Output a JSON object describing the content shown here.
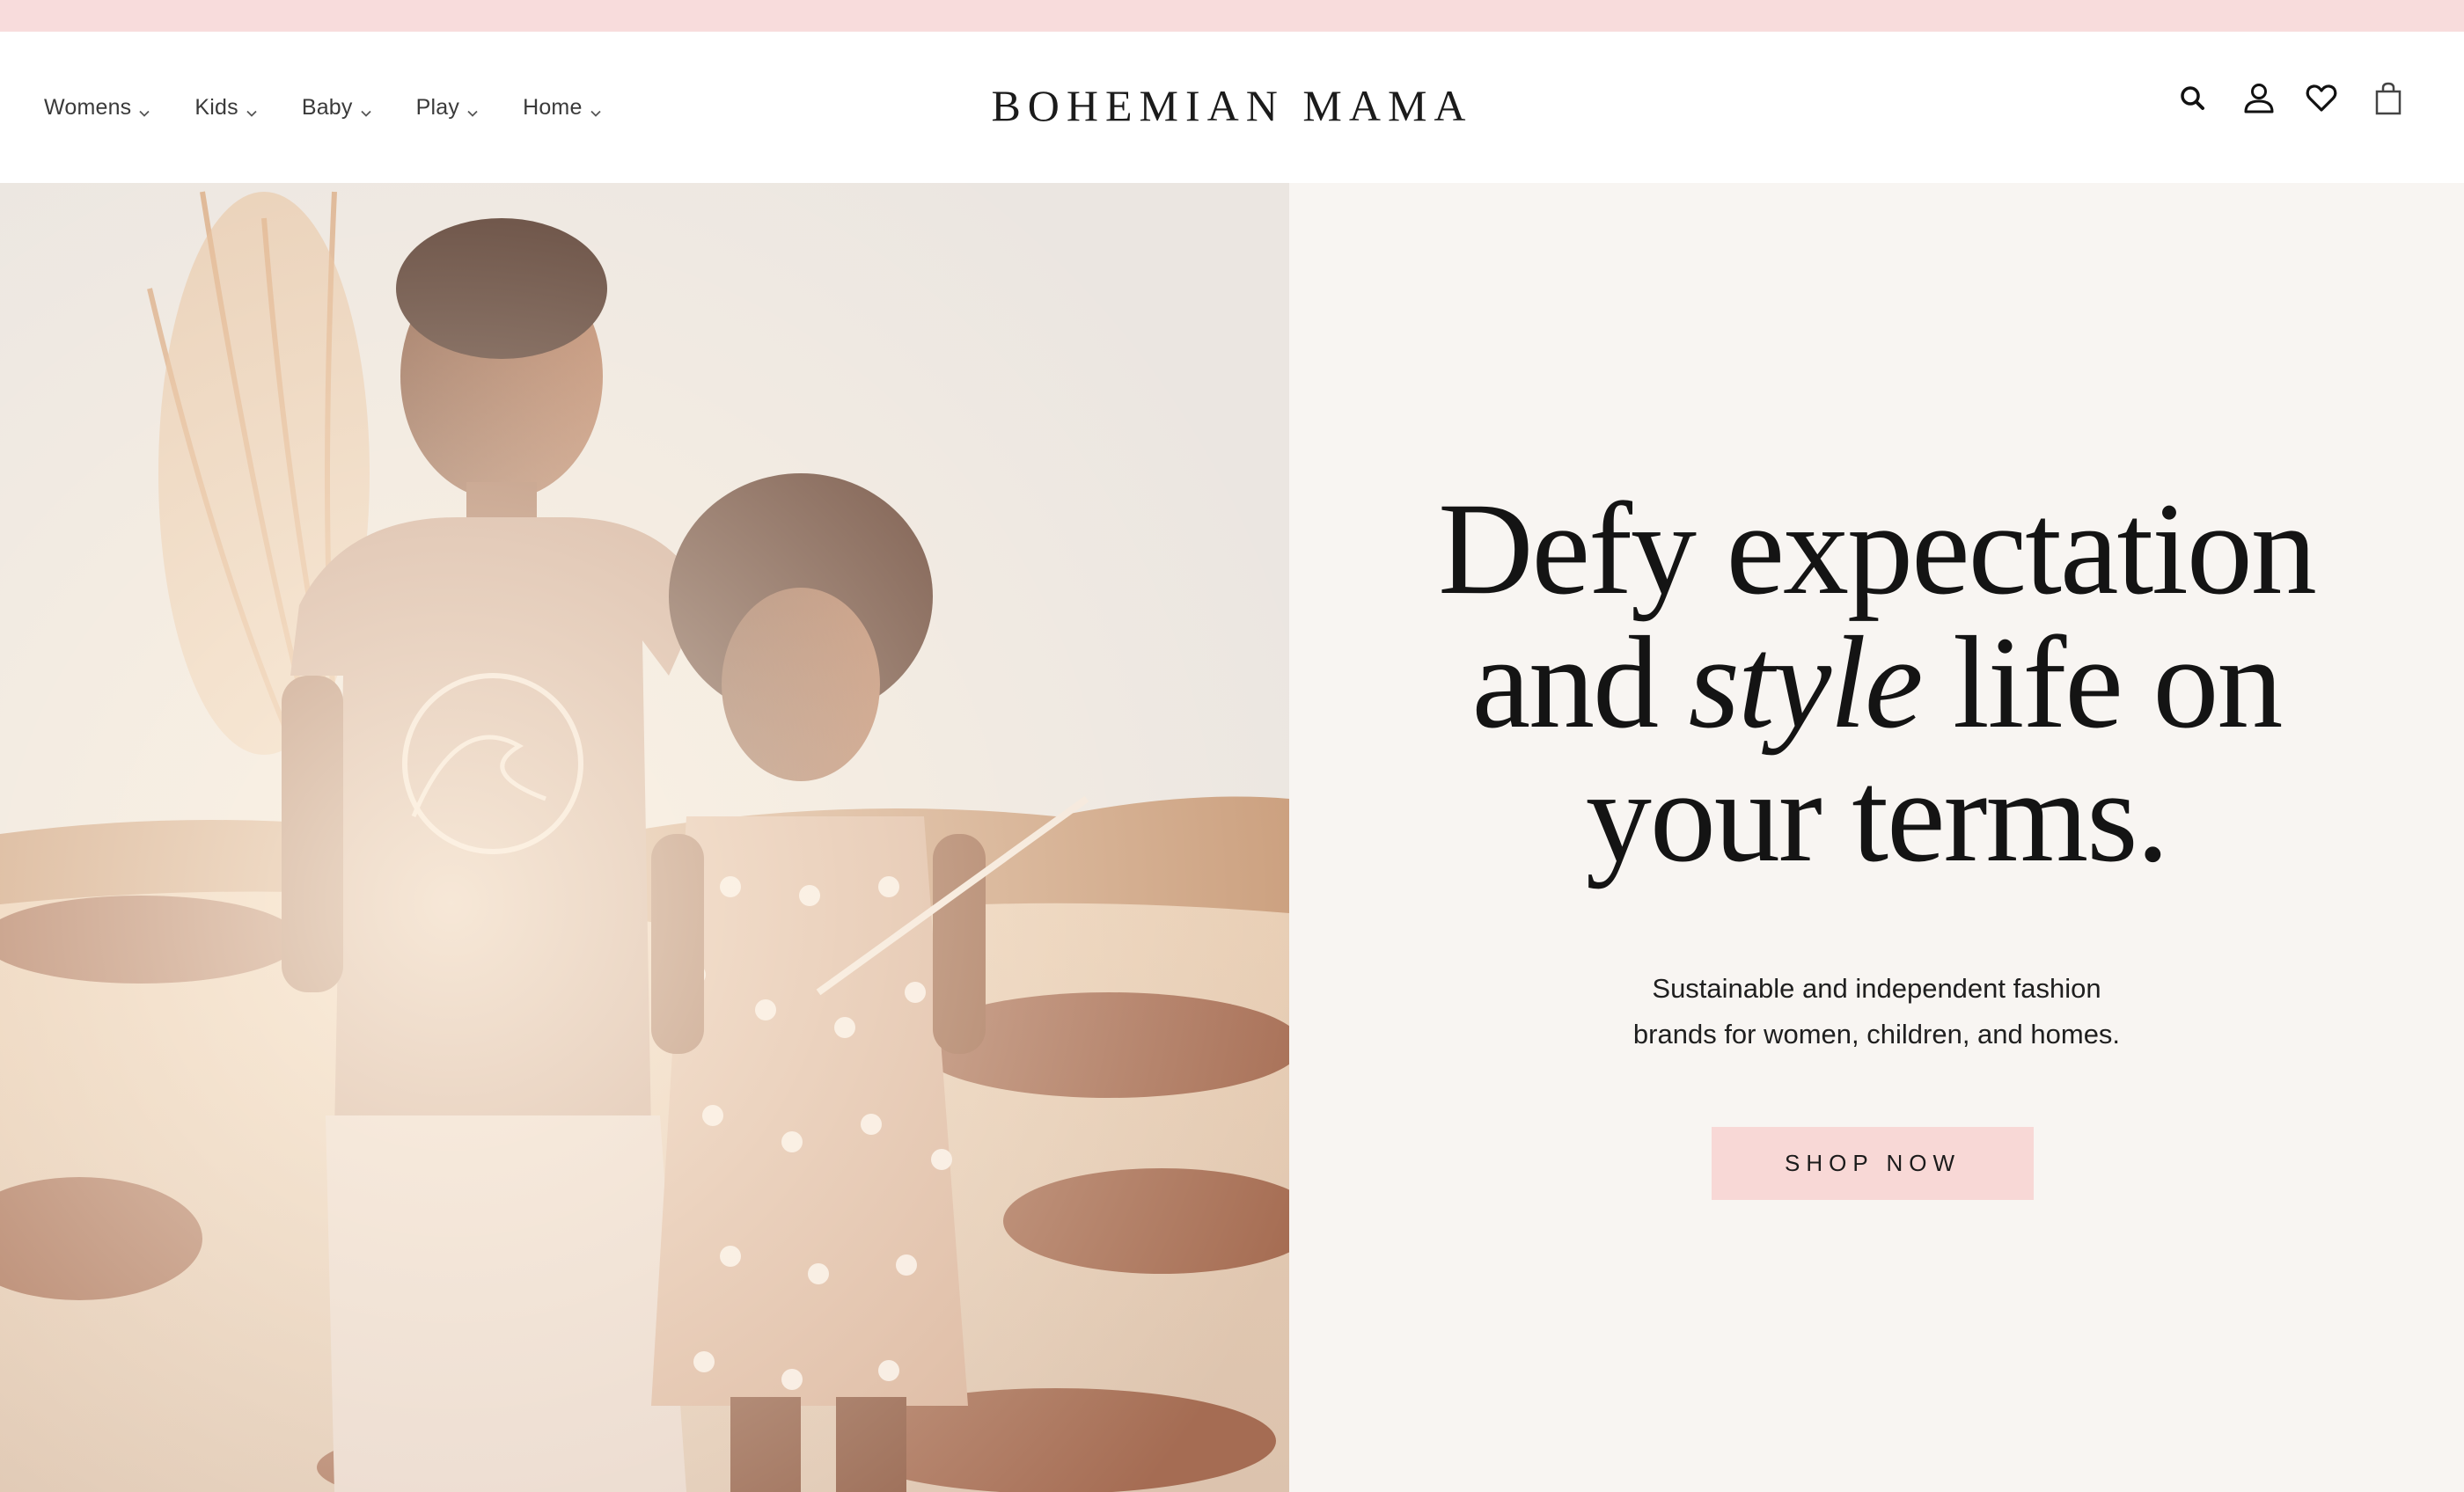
{
  "announcement_bar": {
    "color": "#f8dcdc"
  },
  "brand": {
    "logo_text": "BOHEMIAN MAMA"
  },
  "nav": {
    "items": [
      {
        "label": "Womens",
        "icon": "chevron-down-icon"
      },
      {
        "label": "Kids",
        "icon": "chevron-down-icon"
      },
      {
        "label": "Baby",
        "icon": "chevron-down-icon"
      },
      {
        "label": "Play",
        "icon": "chevron-down-icon"
      },
      {
        "label": "Home",
        "icon": "chevron-down-icon"
      }
    ]
  },
  "header_icons": [
    "search-icon",
    "account-icon",
    "wishlist-heart-icon",
    "cart-bag-icon"
  ],
  "hero": {
    "headline_line1": "Defy expectation",
    "headline_line2_start": "and ",
    "headline_line2_italic": "style",
    "headline_line2_end": " life on",
    "headline_line3": "your terms.",
    "subhead_line1": "Sustainable and independent fashion",
    "subhead_line2": "brands for women, children, and homes.",
    "cta_label": "SHOP NOW",
    "panel_color": "#f8f5f2",
    "cta_color": "#f8d8d6"
  }
}
